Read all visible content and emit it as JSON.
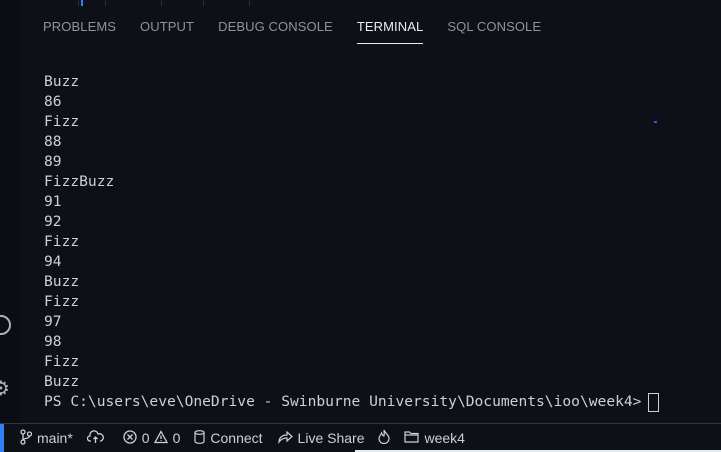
{
  "panel": {
    "tabs": [
      {
        "label": "PROBLEMS"
      },
      {
        "label": "OUTPUT"
      },
      {
        "label": "DEBUG CONSOLE"
      },
      {
        "label": "TERMINAL"
      },
      {
        "label": "SQL CONSOLE"
      }
    ],
    "active_tab": "TERMINAL"
  },
  "terminal": {
    "lines": [
      "Buzz",
      "86",
      "Fizz",
      "88",
      "89",
      "FizzBuzz",
      "91",
      "92",
      "Fizz",
      "94",
      "Buzz",
      "Fizz",
      "97",
      "98",
      "Fizz",
      "Buzz"
    ],
    "prompt": "PS C:\\users\\eve\\OneDrive - Swinburne University\\Documents\\ioo\\week4>"
  },
  "status_bar": {
    "branch": "main*",
    "errors": "0",
    "warnings": "0",
    "connect": "Connect",
    "live_share": "Live Share",
    "folder": "week4"
  },
  "colors": {
    "background": "#0d1117",
    "text": "#c9d1d9",
    "accent": "#2f81f7"
  },
  "icons": {
    "branch": "source-control-icon",
    "sync": "cloud-sync-icon",
    "errors": "error-circle-icon",
    "warnings": "warning-triangle-icon",
    "connect": "database-icon",
    "live_share": "live-share-icon",
    "flame": "flame-icon",
    "folder": "folder-icon"
  }
}
